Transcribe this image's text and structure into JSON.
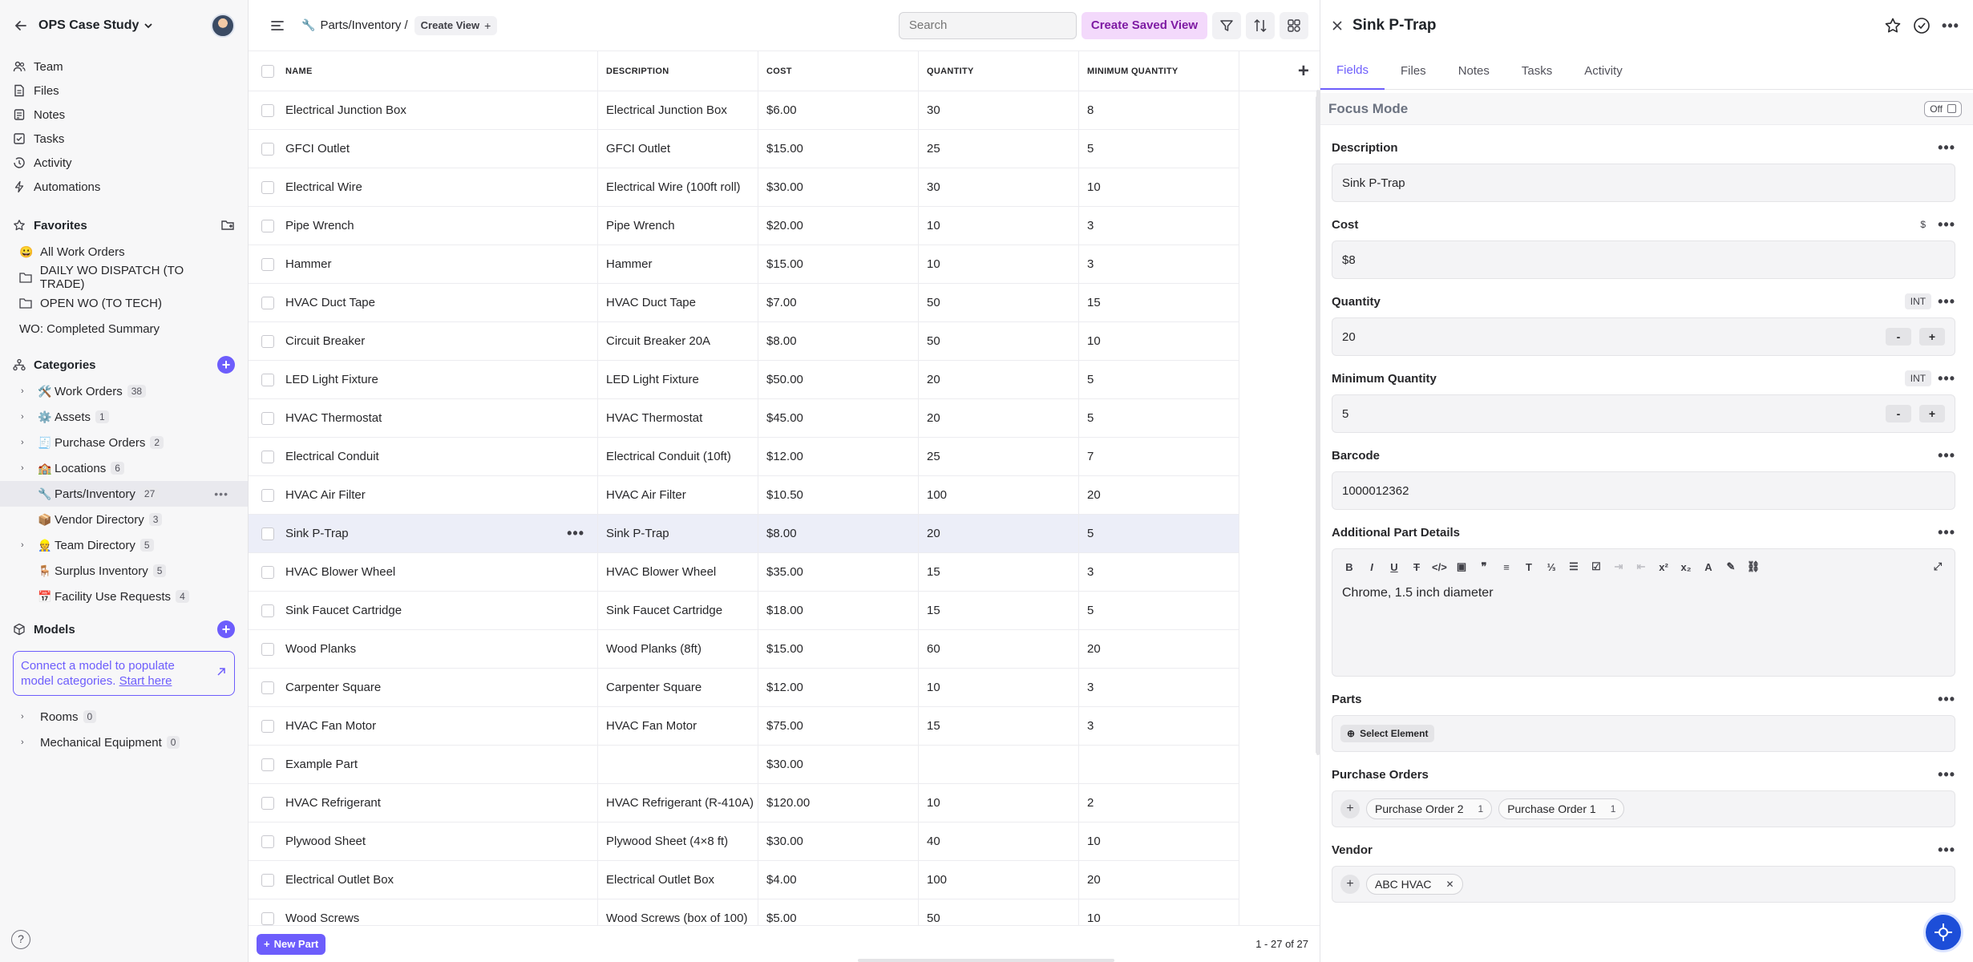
{
  "sidebar": {
    "workspace": "OPS Case Study",
    "nav": [
      {
        "label": "Team",
        "icon": "users-icon"
      },
      {
        "label": "Files",
        "icon": "file-icon"
      },
      {
        "label": "Notes",
        "icon": "note-icon"
      },
      {
        "label": "Tasks",
        "icon": "tasks-icon"
      },
      {
        "label": "Activity",
        "icon": "activity-icon"
      },
      {
        "label": "Automations",
        "icon": "bolt-icon"
      }
    ],
    "favorites_title": "Favorites",
    "favorites": [
      {
        "label": "All Work Orders",
        "icon": "😀"
      },
      {
        "label": "DAILY WO DISPATCH (TO TRADE)",
        "icon": "folder"
      },
      {
        "label": "OPEN WO (TO TECH)",
        "icon": "folder"
      },
      {
        "label": "WO: Completed Summary",
        "icon": ""
      }
    ],
    "categories_title": "Categories",
    "categories": [
      {
        "label": "Work Orders",
        "count": "38",
        "emoji": "🛠️",
        "expandable": true
      },
      {
        "label": "Assets",
        "count": "1",
        "emoji": "⚙️",
        "expandable": true
      },
      {
        "label": "Purchase Orders",
        "count": "2",
        "emoji": "🧾",
        "expandable": true
      },
      {
        "label": "Locations",
        "count": "6",
        "emoji": "🏫",
        "expandable": true
      },
      {
        "label": "Parts/Inventory",
        "count": "27",
        "emoji": "🔧",
        "expandable": false
      },
      {
        "label": "Vendor Directory",
        "count": "3",
        "emoji": "📦",
        "expandable": false
      },
      {
        "label": "Team Directory",
        "count": "5",
        "emoji": "👷",
        "expandable": true
      },
      {
        "label": "Surplus Inventory",
        "count": "5",
        "emoji": "🪑",
        "expandable": false
      },
      {
        "label": "Facility Use Requests",
        "count": "4",
        "emoji": "📅",
        "expandable": false
      }
    ],
    "models_title": "Models",
    "connect_text": "Connect a model to populate model categories.",
    "connect_link": "Start here",
    "models": [
      {
        "label": "Rooms",
        "count": "0"
      },
      {
        "label": "Mechanical Equipment",
        "count": "0"
      }
    ],
    "help": "?"
  },
  "topbar": {
    "breadcrumb": "Parts/Inventory /",
    "create_view": "Create View",
    "search_placeholder": "Search",
    "saved_view": "Create Saved View"
  },
  "table": {
    "columns": [
      "NAME",
      "DESCRIPTION",
      "COST",
      "QUANTITY",
      "MINIMUM QUANTITY"
    ],
    "rows": [
      [
        "Electrical Junction Box",
        "Electrical Junction Box",
        "$6.00",
        "30",
        "8"
      ],
      [
        "GFCI Outlet",
        "GFCI Outlet",
        "$15.00",
        "25",
        "5"
      ],
      [
        "Electrical Wire",
        "Electrical Wire (100ft roll)",
        "$30.00",
        "30",
        "10"
      ],
      [
        "Pipe Wrench",
        "Pipe Wrench",
        "$20.00",
        "10",
        "3"
      ],
      [
        "Hammer",
        "Hammer",
        "$15.00",
        "10",
        "3"
      ],
      [
        "HVAC Duct Tape",
        "HVAC Duct Tape",
        "$7.00",
        "50",
        "15"
      ],
      [
        "Circuit Breaker",
        "Circuit Breaker 20A",
        "$8.00",
        "50",
        "10"
      ],
      [
        "LED Light Fixture",
        "LED Light Fixture",
        "$50.00",
        "20",
        "5"
      ],
      [
        "HVAC Thermostat",
        "HVAC Thermostat",
        "$45.00",
        "20",
        "5"
      ],
      [
        "Electrical Conduit",
        "Electrical Conduit (10ft)",
        "$12.00",
        "25",
        "7"
      ],
      [
        "HVAC Air Filter",
        "HVAC Air Filter",
        "$10.50",
        "100",
        "20"
      ],
      [
        "Sink P-Trap",
        "Sink P-Trap",
        "$8.00",
        "20",
        "5"
      ],
      [
        "HVAC Blower Wheel",
        "HVAC Blower Wheel",
        "$35.00",
        "15",
        "3"
      ],
      [
        "Sink Faucet Cartridge",
        "Sink Faucet Cartridge",
        "$18.00",
        "15",
        "5"
      ],
      [
        "Wood Planks",
        "Wood Planks (8ft)",
        "$15.00",
        "60",
        "20"
      ],
      [
        "Carpenter Square",
        "Carpenter Square",
        "$12.00",
        "10",
        "3"
      ],
      [
        "HVAC Fan Motor",
        "HVAC Fan Motor",
        "$75.00",
        "15",
        "3"
      ],
      [
        "Example Part",
        "",
        "$30.00",
        "",
        ""
      ],
      [
        "HVAC Refrigerant",
        "HVAC Refrigerant (R-410A)",
        "$120.00",
        "10",
        "2"
      ],
      [
        "Plywood Sheet",
        "Plywood Sheet (4×8 ft)",
        "$30.00",
        "40",
        "10"
      ],
      [
        "Electrical Outlet Box",
        "Electrical Outlet Box",
        "$4.00",
        "100",
        "20"
      ],
      [
        "Wood Screws",
        "Wood Screws (box of 100)",
        "$5.00",
        "50",
        "10"
      ]
    ],
    "selected_row": 11,
    "new_part": "New Part",
    "pager": "1 - 27 of 27"
  },
  "panel": {
    "title": "Sink P-Trap",
    "tabs": [
      "Fields",
      "Files",
      "Notes",
      "Tasks",
      "Activity"
    ],
    "focus_mode": "Focus Mode",
    "focus_toggle": "Off",
    "description_label": "Description",
    "description": "Sink P-Trap",
    "cost_label": "Cost",
    "cost_badge": "$",
    "cost": "$8",
    "quantity_label": "Quantity",
    "quantity_badge": "INT",
    "quantity": "20",
    "min_quantity_label": "Minimum Quantity",
    "min_quantity_badge": "INT",
    "min_quantity": "5",
    "step_minus": "-",
    "step_plus": "+",
    "barcode_label": "Barcode",
    "barcode": "1000012362",
    "details_label": "Additional Part Details",
    "details": "Chrome, 1.5 inch diameter",
    "parts_label": "Parts",
    "select_element": "Select Element",
    "po_label": "Purchase Orders",
    "purchase_orders": [
      {
        "label": "Purchase Order 2",
        "count": "1"
      },
      {
        "label": "Purchase Order 1",
        "count": "1"
      }
    ],
    "vendor_label": "Vendor",
    "vendor": "ABC HVAC"
  },
  "colors": {
    "accent": "#6d5dfc",
    "saved_view_bg": "#f3d9fb",
    "saved_view_text": "#7e1aa3",
    "selected_row": "#eceef8"
  }
}
